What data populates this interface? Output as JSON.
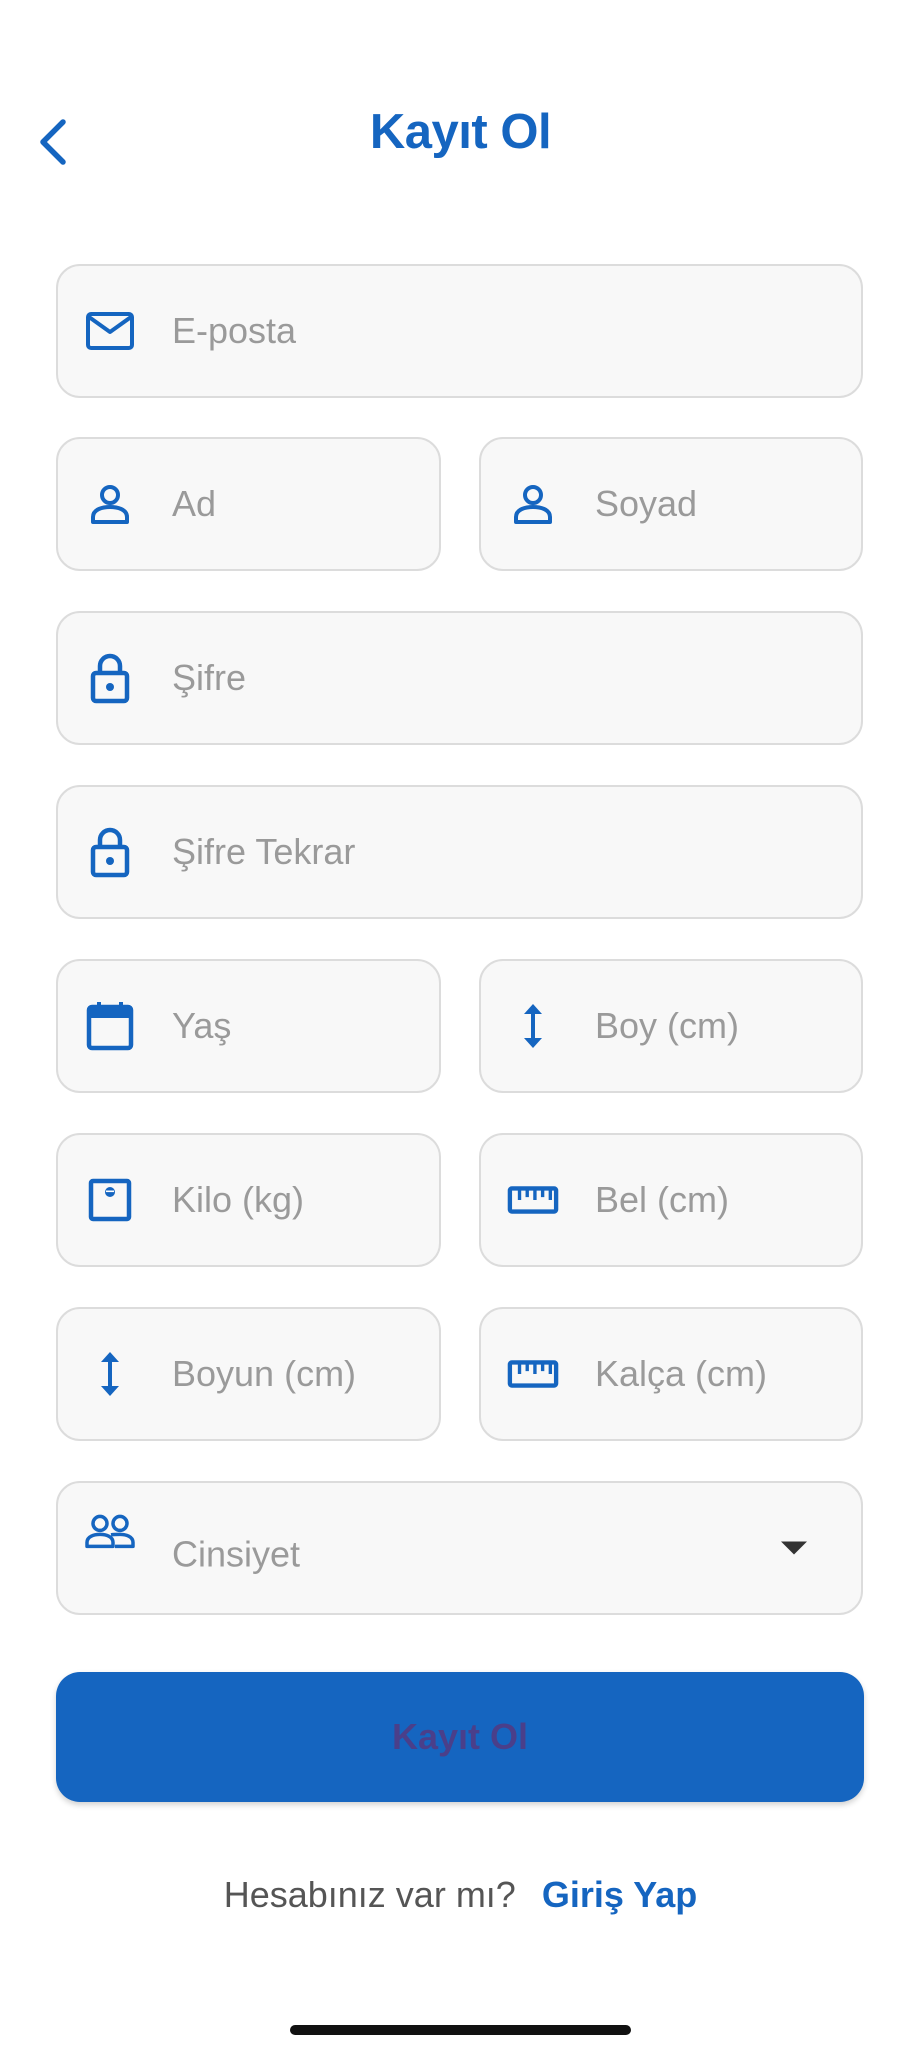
{
  "header": {
    "title": "Kayıt Ol",
    "back_icon": "chevron-left-icon"
  },
  "form": {
    "email": {
      "placeholder": "E-posta",
      "icon": "mail-icon"
    },
    "first_name": {
      "placeholder": "Ad",
      "icon": "person-icon"
    },
    "last_name": {
      "placeholder": "Soyad",
      "icon": "person-icon"
    },
    "password": {
      "placeholder": "Şifre",
      "icon": "lock-icon"
    },
    "password_repeat": {
      "placeholder": "Şifre Tekrar",
      "icon": "lock-icon"
    },
    "age": {
      "placeholder": "Yaş",
      "icon": "calendar-icon"
    },
    "height": {
      "placeholder": "Boy (cm)",
      "icon": "vertical-arrows-icon"
    },
    "weight": {
      "placeholder": "Kilo (kg)",
      "icon": "scale-icon"
    },
    "waist": {
      "placeholder": "Bel (cm)",
      "icon": "ruler-icon"
    },
    "neck": {
      "placeholder": "Boyun (cm)",
      "icon": "vertical-arrows-icon"
    },
    "hip": {
      "placeholder": "Kalça (cm)",
      "icon": "ruler-icon"
    },
    "gender": {
      "placeholder": "Cinsiyet",
      "icon": "people-icon",
      "options_selected": ""
    }
  },
  "submit_label": "Kayıt Ol",
  "footer": {
    "question": "Hesabınız var mı?",
    "login_link": "Giriş Yap"
  },
  "colors": {
    "primary": "#1565c0",
    "field_bg": "#f8f8f8",
    "field_border": "#dcdcdc",
    "placeholder": "#9a9a9a",
    "submit_text": "#4a3f8a"
  }
}
